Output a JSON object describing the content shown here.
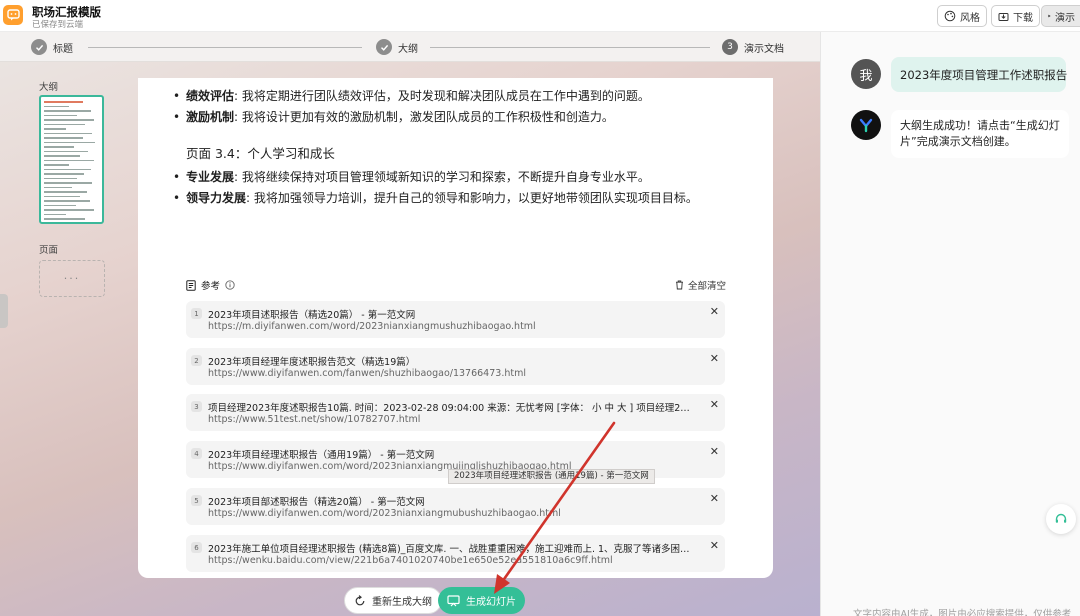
{
  "header": {
    "title": "职场汇报模版",
    "subtitle": "已保存到云端",
    "style_label": "风格",
    "download_label": "下载",
    "present_label": "演示"
  },
  "steps": [
    {
      "label": "标题",
      "state": "done"
    },
    {
      "label": "大纲",
      "state": "done"
    },
    {
      "label": "演示文档",
      "number": "3",
      "state": "current"
    }
  ],
  "sidebar": {
    "outline_label": "大纲",
    "pages_label": "页面",
    "pages_placeholder": "···"
  },
  "document": {
    "bullets_top": [
      {
        "term": "绩效评估",
        "text": ": 我将定期进行团队绩效评估，及时发现和解决团队成员在工作中遇到的问题。"
      },
      {
        "term": "激励机制",
        "text": ": 我将设计更加有效的激励机制，激发团队成员的工作积极性和创造力。"
      }
    ],
    "section_heading": "页面 3.4：个人学习和成长",
    "bullets_bottom": [
      {
        "term": "专业发展",
        "text": ": 我将继续保持对项目管理领域新知识的学习和探索，不断提升自身专业水平。"
      },
      {
        "term": "领导力发展",
        "text": ": 我将加强领导力培训，提升自己的领导和影响力，以更好地带领团队实现项目目标。"
      }
    ]
  },
  "references": {
    "title": "参考",
    "clear_all": "全部清空",
    "items": [
      {
        "num": "1",
        "title": "2023年项目述职报告（精选20篇） - 第一范文网",
        "url": "https://m.diyifanwen.com/word/2023nianxiangmushuzhibaogao.html"
      },
      {
        "num": "2",
        "title": "2023年项目经理年度述职报告范文（精选19篇）",
        "url": "https://www.diyifanwen.com/fanwen/shuzhibaogao/13766473.html"
      },
      {
        "num": "3",
        "title": "项目经理2023年度述职报告10篇. 时间：2023-02-28 09:04:00 来源：无忧考网 [字体： 小 中 大 ] 项目经理2023年...",
        "url": "https://www.51test.net/show/10782707.html"
      },
      {
        "num": "4",
        "title": "2023年项目经理述职报告（通用19篇） - 第一范文网",
        "url": "https://www.diyifanwen.com/word/2023nianxiangmujinglishuzhibaogao.html"
      },
      {
        "num": "5",
        "title": "2023年项目部述职报告（精选20篇） - 第一范文网",
        "url": "https://www.diyifanwen.com/word/2023nianxiangmubushuzhibaogao.html"
      },
      {
        "num": "6",
        "title": "2023年施工单位项目经理述职报告 (精选8篇)_百度文库. 一、战胜重重困难，施工迎难而上. 1、克服了等诸多困难。 2...",
        "url": "https://wenku.baidu.com/view/221b6a7401020740be1e650e52ea551810a6c9ff.html"
      }
    ],
    "tooltip": "2023年项目经理述职报告 (通用19篇) - 第一范文网"
  },
  "actions": {
    "regenerate": "重新生成大纲",
    "generate": "生成幻灯片"
  },
  "chat": {
    "user_avatar": "我",
    "user_message": "2023年度项目管理工作述职报告",
    "bot_message": "大纲生成成功！请点击“生成幻灯片”完成演示文档创建。",
    "footer": "文字内容由AI生成，图片由必应搜索提供，仅供参考"
  },
  "colors": {
    "accent": "#34bf97",
    "logo": "#ff9f2e",
    "annotation_arrow": "#d0342c"
  }
}
